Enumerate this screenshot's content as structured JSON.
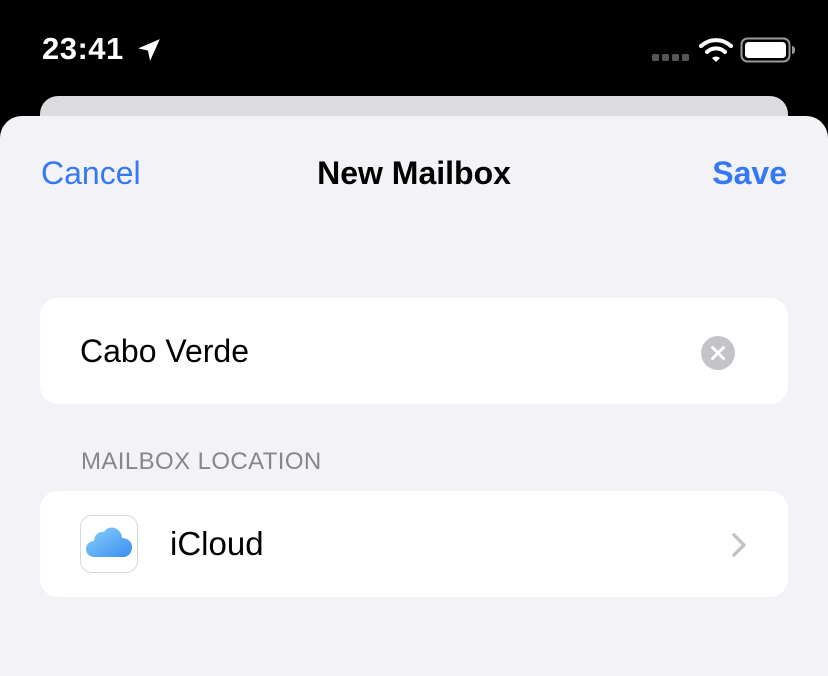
{
  "status_bar": {
    "time": "23:41",
    "icons": [
      "location-arrow-icon",
      "cellular-signal-icon",
      "wifi-icon",
      "battery-icon"
    ]
  },
  "nav": {
    "cancel_label": "Cancel",
    "title": "New Mailbox",
    "save_label": "Save"
  },
  "name_field": {
    "value": "Cabo Verde"
  },
  "location_section": {
    "header": "MAILBOX LOCATION",
    "item_label": "iCloud",
    "item_icon": "icloud-icon"
  },
  "colors": {
    "accent": "#3478f6",
    "sheet_background": "#f2f2f7",
    "secondary_text": "#86868b"
  }
}
